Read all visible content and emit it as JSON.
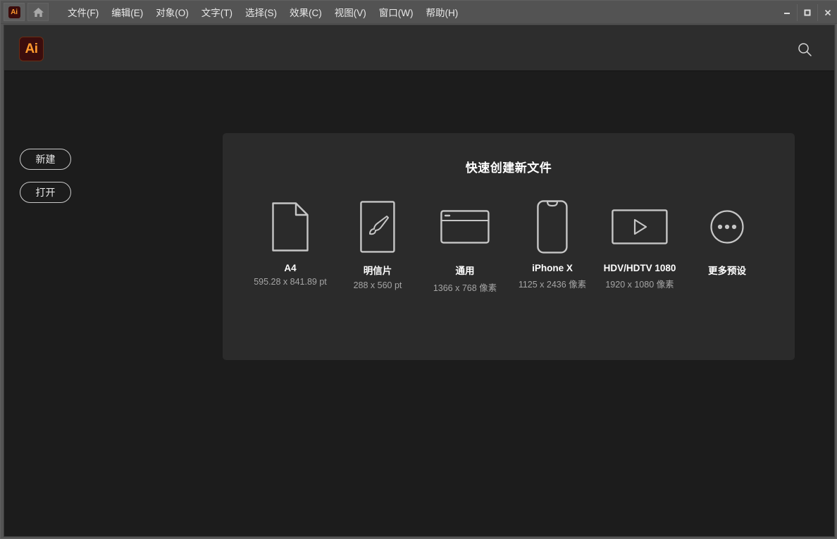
{
  "window": {
    "app_badge": "Ai",
    "home_icon": "home-icon",
    "controls": [
      {
        "name": "minimize-button",
        "glyph": "minimize-icon",
        "label": "—"
      },
      {
        "name": "maximize-button",
        "glyph": "maximize-icon",
        "label": "□"
      },
      {
        "name": "close-button",
        "glyph": "close-icon",
        "label": "✕"
      }
    ]
  },
  "menubar": {
    "items": [
      {
        "label": "文件(F)"
      },
      {
        "label": "编辑(E)"
      },
      {
        "label": "对象(O)"
      },
      {
        "label": "文字(T)"
      },
      {
        "label": "选择(S)"
      },
      {
        "label": "效果(C)"
      },
      {
        "label": "视图(V)"
      },
      {
        "label": "窗口(W)"
      },
      {
        "label": "帮助(H)"
      }
    ]
  },
  "header": {
    "logo_text": "Ai",
    "search_icon": "search-icon"
  },
  "sidebar": {
    "buttons": [
      {
        "label": "新建",
        "name": "new-document-button"
      },
      {
        "label": "打开",
        "name": "open-document-button"
      }
    ]
  },
  "quick_create": {
    "title": "快速创建新文件",
    "presets": [
      {
        "label": "A4",
        "size": "595.28 x 841.89 pt",
        "icon": "document-page-icon"
      },
      {
        "label": "明信片",
        "size": "288 x 560 pt",
        "icon": "paintbrush-icon"
      },
      {
        "label": "通用",
        "size": "1366 x 768 像素",
        "icon": "browser-window-icon"
      },
      {
        "label": "iPhone X",
        "size": "1125 x 2436 像素",
        "icon": "phone-notch-icon"
      },
      {
        "label": "HDV/HDTV 1080",
        "size": "1920 x 1080 像素",
        "icon": "video-play-icon"
      },
      {
        "label": "更多预设",
        "size": "",
        "icon": "ellipsis-circle-icon"
      }
    ]
  },
  "colors": {
    "window_chrome": "#535353",
    "app_background": "#1c1c1c",
    "header_bar": "#2d2d2d",
    "panel_background": "#2b2b2b",
    "brand_orange": "#ff9a2e",
    "brand_dark": "#3b0d0d",
    "text_primary": "#ffffff",
    "text_secondary": "#a5a5a5"
  }
}
